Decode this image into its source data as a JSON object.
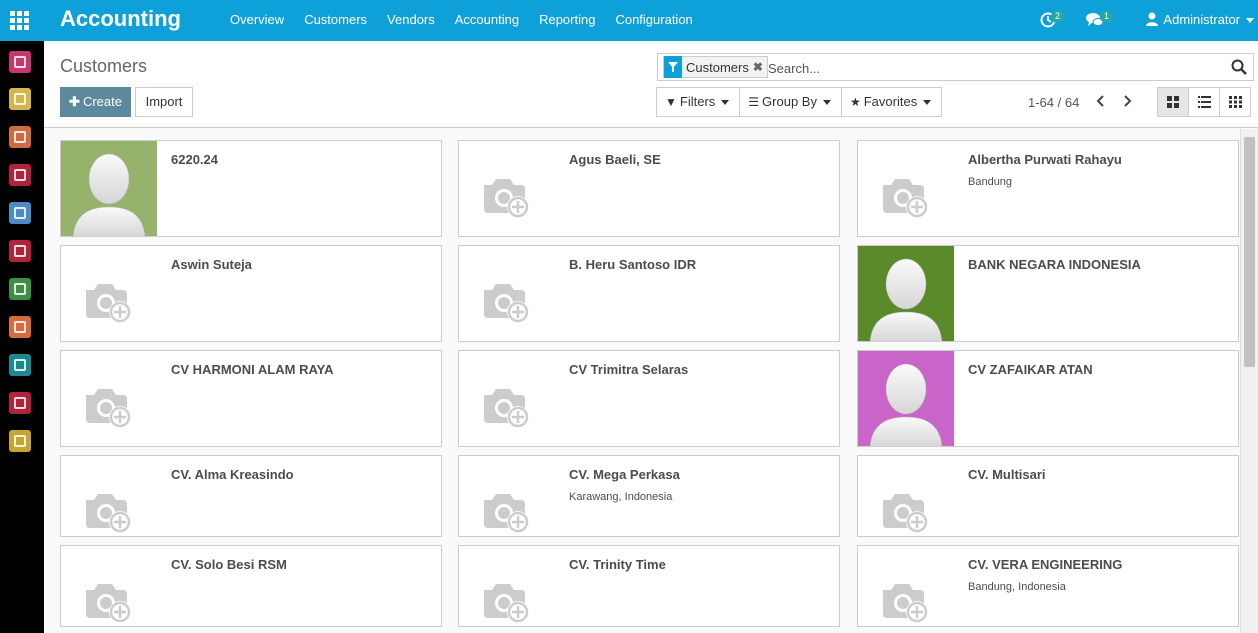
{
  "app": {
    "title": "Accounting"
  },
  "topmenu": {
    "items": [
      {
        "label": "Overview"
      },
      {
        "label": "Customers"
      },
      {
        "label": "Vendors"
      },
      {
        "label": "Accounting"
      },
      {
        "label": "Reporting"
      },
      {
        "label": "Configuration"
      }
    ]
  },
  "systray": {
    "activity_count": "2",
    "messages_count": "1",
    "user_name": "Administrator"
  },
  "sidebar": {
    "apps": [
      {
        "icon": "discuss-icon",
        "color": "#c7376d"
      },
      {
        "icon": "calendar-icon",
        "color": "#d3b74b"
      },
      {
        "icon": "sales-chart-icon",
        "color": "#d26a3f"
      },
      {
        "icon": "inventory-icon",
        "color": "#b0233a"
      },
      {
        "icon": "accounting-icon",
        "color": "#4b8cc4"
      },
      {
        "icon": "purchase-icon",
        "color": "#b0233a"
      },
      {
        "icon": "tools-icon",
        "color": "#3c8f43"
      },
      {
        "icon": "invoicing-icon",
        "color": "#d86a3c"
      },
      {
        "icon": "employees-icon",
        "color": "#1b8a8f"
      },
      {
        "icon": "apps-icon",
        "color": "#b0233a"
      },
      {
        "icon": "settings-icon",
        "color": "#c3a52f"
      }
    ]
  },
  "control_panel": {
    "breadcrumb": "Customers",
    "create_label": "Create",
    "import_label": "Import",
    "search": {
      "facet_label": "Customers",
      "placeholder": "Search..."
    },
    "filters_label": "Filters",
    "group_by_label": "Group By",
    "favorites_label": "Favorites",
    "pager": "1-64 / 64"
  },
  "kanban": {
    "cards": [
      {
        "name": "6220.24",
        "subtitle": "",
        "avatar": "person",
        "avatar_bg": "#97b26b"
      },
      {
        "name": "Agus Baeli, SE",
        "subtitle": "",
        "avatar": "placeholder"
      },
      {
        "name": "Albertha Purwati Rahayu",
        "subtitle": "Bandung",
        "avatar": "placeholder"
      },
      {
        "name": "Aswin Suteja",
        "subtitle": "",
        "avatar": "placeholder"
      },
      {
        "name": "B. Heru Santoso IDR",
        "subtitle": "",
        "avatar": "placeholder"
      },
      {
        "name": "BANK NEGARA INDONESIA",
        "subtitle": "",
        "avatar": "person",
        "avatar_bg": "#5a8a2a"
      },
      {
        "name": "CV HARMONI ALAM RAYA",
        "subtitle": "",
        "avatar": "placeholder"
      },
      {
        "name": "CV Trimitra Selaras",
        "subtitle": "",
        "avatar": "placeholder"
      },
      {
        "name": "CV ZAFAIKAR ATAN",
        "subtitle": "",
        "avatar": "person",
        "avatar_bg": "#c964c9"
      },
      {
        "name": "CV. Alma Kreasindo",
        "subtitle": "",
        "avatar": "placeholder"
      },
      {
        "name": "CV. Mega Perkasa",
        "subtitle": "Karawang, Indonesia",
        "avatar": "placeholder"
      },
      {
        "name": "CV. Multisari",
        "subtitle": "",
        "avatar": "placeholder"
      },
      {
        "name": "CV. Solo Besi RSM",
        "subtitle": "",
        "avatar": "placeholder"
      },
      {
        "name": "CV. Trinity Time",
        "subtitle": "",
        "avatar": "placeholder"
      },
      {
        "name": "CV. VERA ENGINEERING",
        "subtitle": "Bandung, Indonesia",
        "avatar": "placeholder"
      }
    ]
  },
  "colors": {
    "navbar": "#0ea0d9",
    "primary_button": "#5b899e"
  }
}
